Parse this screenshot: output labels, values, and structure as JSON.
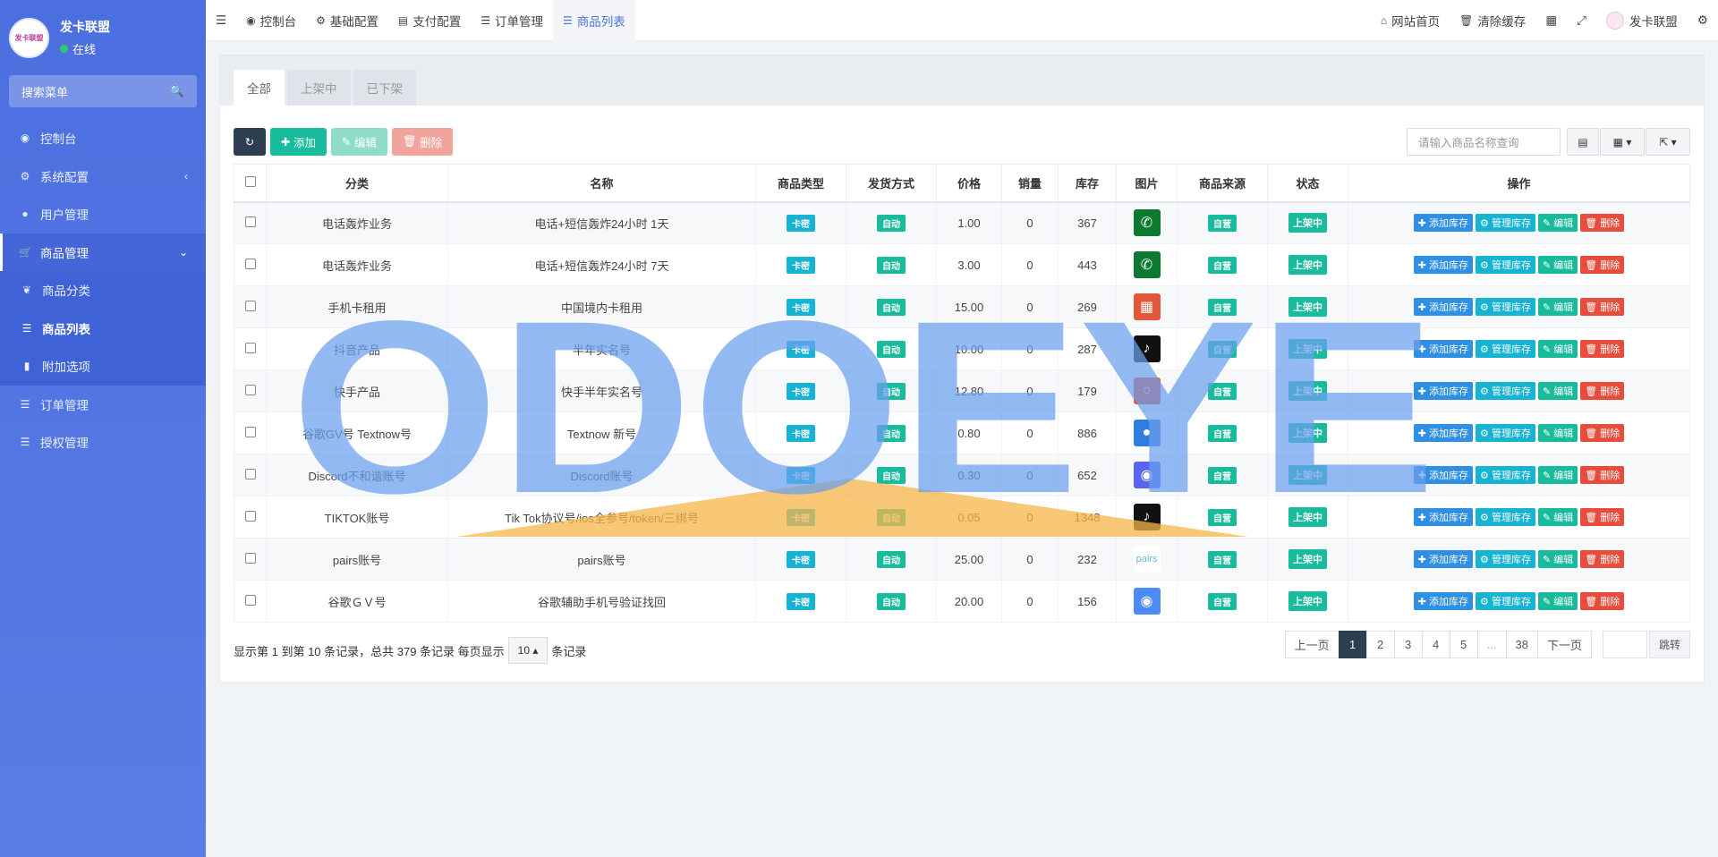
{
  "sidebar": {
    "logo_text": "发卡联盟",
    "user_name": "发卡联盟",
    "status": "在线",
    "search_placeholder": "搜索菜单",
    "items": [
      {
        "label": "控制台",
        "icon": "dashboard-icon"
      },
      {
        "label": "系统配置",
        "icon": "gear-icon"
      },
      {
        "label": "用户管理",
        "icon": "user-icon"
      },
      {
        "label": "商品管理",
        "icon": "cart-icon"
      },
      {
        "label": "商品分类",
        "icon": "leaf-icon"
      },
      {
        "label": "商品列表",
        "icon": "list-icon"
      },
      {
        "label": "附加选项",
        "icon": "bookmark-icon"
      },
      {
        "label": "订单管理",
        "icon": "list-icon"
      },
      {
        "label": "授权管理",
        "icon": "list-icon"
      }
    ]
  },
  "topbar": {
    "tabs": [
      {
        "label": "控制台"
      },
      {
        "label": "基础配置"
      },
      {
        "label": "支付配置"
      },
      {
        "label": "订单管理"
      },
      {
        "label": "商品列表"
      }
    ],
    "home": "网站首页",
    "clear_cache": "清除缓存",
    "user": "发卡联盟"
  },
  "tabs": [
    "全部",
    "上架中",
    "已下架"
  ],
  "toolbar": {
    "add": "添加",
    "edit": "编辑",
    "delete": "删除",
    "search_placeholder": "请输入商品名称查询"
  },
  "table": {
    "headers": [
      "分类",
      "名称",
      "商品类型",
      "发货方式",
      "价格",
      "销量",
      "库存",
      "图片",
      "商品来源",
      "状态",
      "操作"
    ],
    "rows": [
      {
        "category": "电话轰炸业务",
        "name": "电话+短信轰炸24小时 1天",
        "type": "卡密",
        "delivery": "自动",
        "price": "1.00",
        "sales": "0",
        "stock": "367",
        "source": "自营",
        "status": "上架中"
      },
      {
        "category": "电话轰炸业务",
        "name": "电话+短信轰炸24小时 7天",
        "type": "卡密",
        "delivery": "自动",
        "price": "3.00",
        "sales": "0",
        "stock": "443",
        "source": "自营",
        "status": "上架中"
      },
      {
        "category": "手机卡租用",
        "name": "中国境内卡租用",
        "type": "卡密",
        "delivery": "自动",
        "price": "15.00",
        "sales": "0",
        "stock": "269",
        "source": "自营",
        "status": "上架中"
      },
      {
        "category": "抖音产品",
        "name": "半年实名号",
        "type": "卡密",
        "delivery": "自动",
        "price": "10.00",
        "sales": "0",
        "stock": "287",
        "source": "自营",
        "status": "上架中"
      },
      {
        "category": "快手产品",
        "name": "快手半年实名号",
        "type": "卡密",
        "delivery": "自动",
        "price": "12.80",
        "sales": "0",
        "stock": "179",
        "source": "自营",
        "status": "上架中"
      },
      {
        "category": "谷歌GV号 Textnow号",
        "name": "Textnow 新号",
        "type": "卡密",
        "delivery": "自动",
        "price": "0.80",
        "sales": "0",
        "stock": "886",
        "source": "自营",
        "status": "上架中"
      },
      {
        "category": "Discord不和谐账号",
        "name": "Discord账号",
        "type": "卡密",
        "delivery": "自动",
        "price": "0.30",
        "sales": "0",
        "stock": "652",
        "source": "自营",
        "status": "上架中"
      },
      {
        "category": "TIKTOK账号",
        "name": "Tik Tok协议号/ios全参号/token/三绑号",
        "type": "卡密",
        "delivery": "自动",
        "price": "0.05",
        "sales": "0",
        "stock": "1348",
        "source": "自营",
        "status": "上架中"
      },
      {
        "category": "pairs账号",
        "name": "pairs账号",
        "type": "卡密",
        "delivery": "自动",
        "price": "25.00",
        "sales": "0",
        "stock": "232",
        "source": "自营",
        "status": "上架中"
      },
      {
        "category": "谷歌ＧＶ号",
        "name": "谷歌辅助手机号验证找回",
        "type": "卡密",
        "delivery": "自动",
        "price": "20.00",
        "sales": "0",
        "stock": "156",
        "source": "自营",
        "status": "上架中"
      }
    ],
    "ops": {
      "add_stock": "添加库存",
      "manage_stock": "管理库存",
      "edit": "编辑",
      "delete": "删除"
    }
  },
  "footer": {
    "info_prefix": "显示第 1 到第 10 条记录，总共 379 条记录 每页显示",
    "page_size": "10",
    "info_suffix": "条记录"
  },
  "pagination": {
    "prev": "上一页",
    "pages": [
      "1",
      "2",
      "3",
      "4",
      "5",
      "...",
      "38"
    ],
    "next": "下一页",
    "jump": "跳转"
  },
  "watermark": "ODOEYE"
}
